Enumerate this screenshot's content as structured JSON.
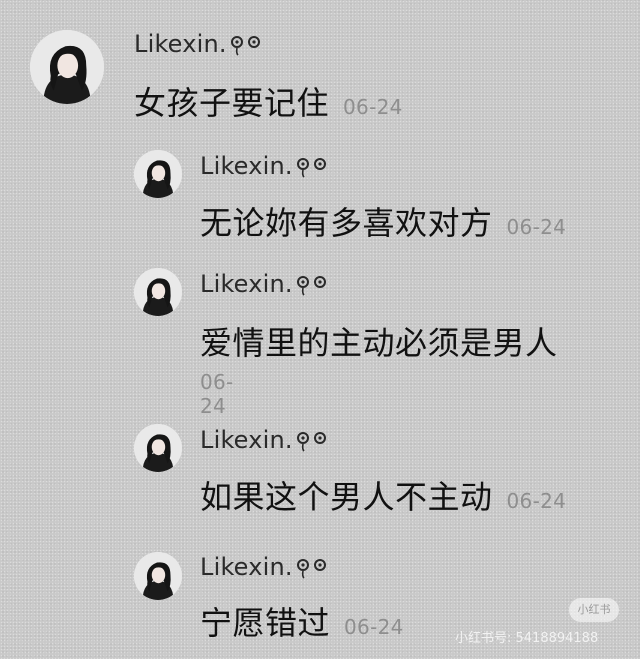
{
  "comments": [
    {
      "username": "Likexin.",
      "emoticon": "ಥಥ",
      "text": "女孩子要记住",
      "date": "06-24"
    },
    {
      "username": "Likexin.",
      "emoticon": "ಥಥ",
      "text": "无论妳有多喜欢对方",
      "date": "06-24"
    },
    {
      "username": "Likexin.",
      "emoticon": "ಥಥ",
      "text": "爱情里的主动必须是男人",
      "date": "06-24"
    },
    {
      "username": "Likexin.",
      "emoticon": "ಥಥ",
      "text": "如果这个男人不主动",
      "date": "06-24"
    },
    {
      "username": "Likexin.",
      "emoticon": "ಥಥ",
      "text": "宁愿错过",
      "date": "06-24"
    }
  ],
  "watermark": {
    "badge": "小红书",
    "user_id": "小红书号: 5418894188"
  },
  "colors": {
    "background": "#c9c9c9",
    "text": "#111111",
    "date": "#8e8e8e"
  },
  "icons": [
    "avatar-photo",
    "crying-emoticon"
  ]
}
